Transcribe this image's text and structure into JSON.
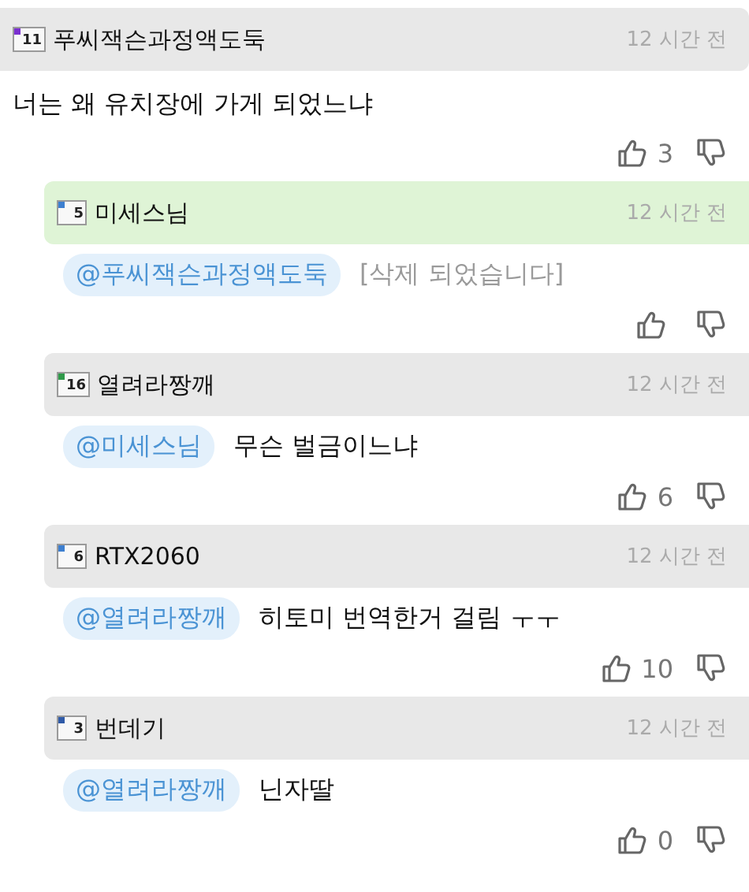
{
  "comment": {
    "author": "푸씨잭슨과정액도둑",
    "badge": {
      "text": "11",
      "color": "#7a2fd0"
    },
    "time": "12 시간 전",
    "highlighted": false,
    "text": "너는 왜 유치장에 가게 되었느냐",
    "likes": "3"
  },
  "replies": [
    {
      "author": "미세스님",
      "badge": {
        "text": "5",
        "color": "#3d7fd0"
      },
      "time": "12 시간 전",
      "highlighted": true,
      "mention": "@푸씨잭슨과정액도둑",
      "kind": "deleted",
      "text": "[삭제 되었습니다]"
    },
    {
      "author": "열려라짱깨",
      "badge": {
        "text": "16",
        "color": "#2f9a4a"
      },
      "time": "12 시간 전",
      "highlighted": false,
      "mention": "@미세스님",
      "kind": "normal",
      "text": "무슨 벌금이느냐",
      "likes": "6"
    },
    {
      "author": "RTX2060",
      "badge": {
        "text": "6",
        "color": "#3d7fd0"
      },
      "time": "12 시간 전",
      "highlighted": false,
      "mention": "@열려라짱깨",
      "kind": "normal",
      "text": "히토미 번역한거 걸림 ㅜㅜ",
      "likes": "10"
    },
    {
      "author": "번데기",
      "badge": {
        "text": "3",
        "color": "#2f5aa8"
      },
      "time": "12 시간 전",
      "highlighted": false,
      "mention": "@열려라짱깨",
      "kind": "normal",
      "text": "닌자딸",
      "likes": "0"
    }
  ]
}
